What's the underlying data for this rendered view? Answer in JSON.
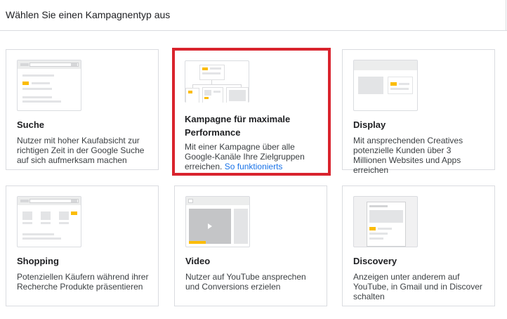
{
  "header": {
    "title": "Wählen Sie einen Kampagnentyp aus"
  },
  "cards": [
    {
      "title": "Suche",
      "description": "Nutzer mit hoher Kaufabsicht zur richtigen Zeit in der Google Suche auf sich aufmerksam machen"
    },
    {
      "title": "Kampagne für maximale Performance",
      "description": "Mit einer Kampagne über alle Google-Kanäle Ihre Zielgruppen erreichen.",
      "link": "So funktionierts",
      "selected": true
    },
    {
      "title": "Display",
      "description": "Mit ansprechenden Creatives potenzielle Kunden über 3 Millionen Websites und Apps erreichen"
    },
    {
      "title": "Shopping",
      "description": "Potenziellen Käufern während ihrer Recherche Produkte präsentieren"
    },
    {
      "title": "Video",
      "description": "Nutzer auf YouTube ansprechen und Conversions erzielen"
    },
    {
      "title": "Discovery",
      "description": "Anzeigen unter anderem auf YouTube, in Gmail und in Discover schalten"
    }
  ],
  "colors": {
    "selected_border": "#d9232d",
    "accent_yellow": "#fbbc04",
    "link": "#1a73e8"
  }
}
